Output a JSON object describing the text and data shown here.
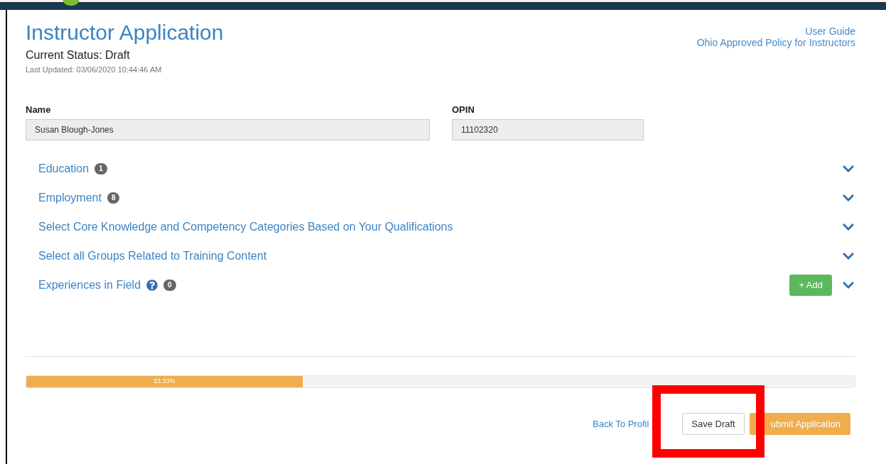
{
  "header": {
    "title": "Instructor Application",
    "status": "Current Status: Draft",
    "last_updated": "Last Updated: 03/06/2020 10:44:46 AM",
    "links": [
      "User Guide",
      "Ohio Approved Policy for Instructors"
    ]
  },
  "fields": [
    {
      "label": "Name",
      "value": "Susan Blough-Jones"
    },
    {
      "label": "OPIN",
      "value": "11102320"
    }
  ],
  "sections": [
    {
      "title": "Education",
      "count": "1",
      "expanded": false
    },
    {
      "title": "Employment",
      "count": "8",
      "expanded": false
    },
    {
      "title": "Select Core Knowledge and Competency Categories Based on Your Qualifications",
      "expanded": false
    },
    {
      "title": "Select all Groups Related to Training Content",
      "expanded": false
    },
    {
      "title": "Experiences in Field",
      "help": true,
      "count": "0",
      "add_button": "+ Add",
      "expanded": false
    }
  ],
  "progress": {
    "level": 0.3333,
    "reading": "33.33%"
  },
  "actions": {
    "back_link": "Back To Profil",
    "save": "Save Draft",
    "submit": "ubmit Application"
  },
  "annotation": {
    "kind": "highlight-box"
  }
}
